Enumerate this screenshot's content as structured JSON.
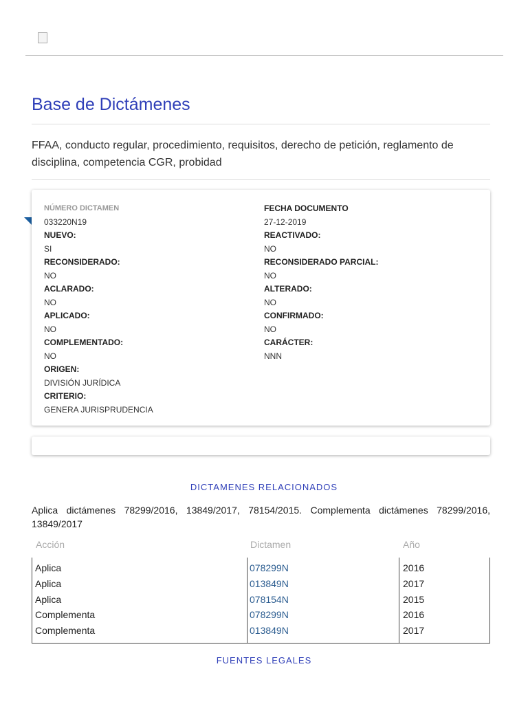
{
  "header": {
    "logo_alt": "broken-image"
  },
  "title": "Base de Dictámenes",
  "keywords": "FFAA, conducto regular, procedimiento, requisitos, derecho de petición, reglamento de disciplina, competencia CGR, probidad",
  "details": {
    "left": [
      {
        "label": "NÚMERO DICTAMEN",
        "value": "033220N19"
      },
      {
        "label": "NUEVO:",
        "value": "SI"
      },
      {
        "label": "RECONSIDERADO:",
        "value": "NO"
      },
      {
        "label": "ACLARADO:",
        "value": "NO"
      },
      {
        "label": "APLICADO:",
        "value": "NO"
      },
      {
        "label": "COMPLEMENTADO:",
        "value": "NO"
      },
      {
        "label": "ORIGEN:",
        "value": "DIVISIÓN JURÍDICA"
      },
      {
        "label": "CRITERIO:",
        "value": "GENERA JURISPRUDENCIA"
      }
    ],
    "right": [
      {
        "label": "FECHA DOCUMENTO",
        "value": "27-12-2019"
      },
      {
        "label": "REACTIVADO:",
        "value": "NO"
      },
      {
        "label": "RECONSIDERADO PARCIAL:",
        "value": "NO"
      },
      {
        "label": "ALTERADO:",
        "value": "NO"
      },
      {
        "label": "CONFIRMADO:",
        "value": "NO"
      },
      {
        "label": "CARÁCTER:",
        "value": "NNN"
      }
    ]
  },
  "related": {
    "heading": "DICTAMENES RELACIONADOS",
    "line1": "Aplica dictámenes 78299/2016, 13849/2017, 78154/2015. Complementa dictámenes 78299/2016,",
    "line2": "13849/2017",
    "headers": [
      "Acción",
      "Dictamen",
      "Año"
    ],
    "rows": [
      [
        "Aplica",
        "078299N",
        "2016"
      ],
      [
        "Aplica",
        "013849N",
        "2017"
      ],
      [
        "Aplica",
        "078154N",
        "2015"
      ],
      [
        "Complementa",
        "078299N",
        "2016"
      ],
      [
        "Complementa",
        "013849N",
        "2017"
      ]
    ]
  },
  "legal": {
    "heading": "FUENTES LEGALES"
  }
}
